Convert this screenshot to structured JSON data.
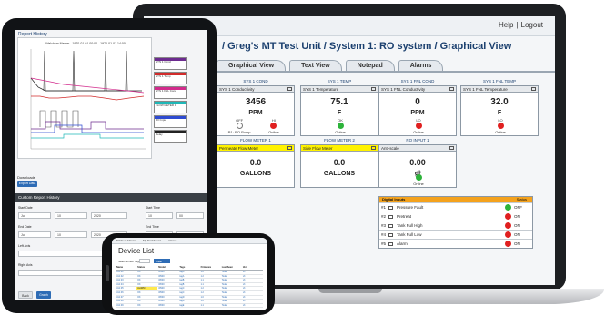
{
  "laptop": {
    "header_links": [
      "Help",
      "Logout"
    ],
    "page_title": "/ Greg's MT Test Unit / System 1: RO system / Graphical View",
    "tabs": [
      "Graphical View",
      "Text View",
      "Notepad",
      "Alarms"
    ],
    "cards": [
      {
        "caption": "SYS 1 COND",
        "header": "SYS 1 Conductivity",
        "value": "3456",
        "unit": "PPM",
        "indicators": [
          {
            "color": "white",
            "label": "OFF",
            "sub": "R1: RO Pump"
          },
          {
            "color": "red",
            "label": "HI",
            "sub": "Online"
          }
        ]
      },
      {
        "caption": "SYS 1 TEMP",
        "header": "SYS 1 Temperature",
        "value": "75.1",
        "unit": "F",
        "indicators": [
          {
            "color": "green",
            "label": "OK",
            "sub": "Online"
          }
        ]
      },
      {
        "caption": "SYS 1 FNL COND",
        "header": "SYS 1 FNL Conductivity",
        "value": "0",
        "unit": "PPM",
        "indicators": [
          {
            "color": "red",
            "label": "LO",
            "sub": "Online"
          }
        ]
      },
      {
        "caption": "SYS 1 FNL TEMP",
        "header": "SYS 1 FNL Temperature",
        "value": "32.0",
        "unit": "F",
        "indicators": [
          {
            "color": "red",
            "label": "LO",
            "sub": "Online"
          }
        ]
      },
      {
        "caption": "FLOW METER 1",
        "header": "Permeate Flow Meter",
        "value": "0.0",
        "unit": "GALLONS",
        "yellow": true,
        "indicators": []
      },
      {
        "caption": "FLOW METER 2",
        "header": "Side Flow Meter",
        "value": "0.0",
        "unit": "GALLONS",
        "yellow": true,
        "indicators": []
      },
      {
        "caption": "RO INPUT 1",
        "header": "Anti-scale",
        "value": "0.00",
        "unit": "gl",
        "indicators": [
          {
            "color": "green",
            "label": "OK",
            "sub": "Online"
          }
        ]
      }
    ],
    "alarms": {
      "header_left": "Digital Inputs",
      "header_right": "Status",
      "rows": [
        {
          "num": "#1",
          "label": "Pressure Fault",
          "status": "OFF",
          "color": "green"
        },
        {
          "num": "#2",
          "label": "Pretreat",
          "status": "ON",
          "color": "red"
        },
        {
          "num": "#3",
          "label": "Tank Full High",
          "status": "ON",
          "color": "red"
        },
        {
          "num": "#4",
          "label": "Tank Full Low",
          "status": "ON",
          "color": "red"
        },
        {
          "num": "#5",
          "label": "Alarm",
          "status": "ON",
          "color": "red"
        }
      ]
    }
  },
  "tablet": {
    "title": "Report History",
    "chart_header": "Walchem Master - 1970-01-01 00:00 - 1970-01-01 14:00",
    "legend": [
      {
        "color": "#6c2b8f",
        "text": "SYS 1 Cond"
      },
      {
        "color": "#d22b2b",
        "text": "SYS 1 Temp"
      },
      {
        "color": "#d22b8c",
        "text": "SYS 1 FNL Cond"
      },
      {
        "color": "#1fb8b8",
        "text": "FLOW METER 1"
      },
      {
        "color": "#2e4bd1",
        "text": "RO Input"
      },
      {
        "color": "#222222",
        "text": "Relay"
      }
    ],
    "downloads_label": "Downloads",
    "export_button": "Export Data",
    "section_title": "Custom Report History",
    "fields": {
      "start_date_label": "Start Date",
      "start_time_label": "Start Time",
      "end_date_label": "End Date",
      "end_time_label": "End Time",
      "left_axis_label": "Left Axis",
      "right_axis_label": "Right Axis",
      "start_month": "Jul",
      "start_day": "10",
      "start_year": "2020",
      "start_hour": "10",
      "start_min": "00",
      "end_month": "Jul",
      "end_day": "10",
      "end_year": "2020",
      "end_hour": "14",
      "end_min": "00"
    },
    "buttons": {
      "left": "Back",
      "right": "Graph"
    }
  },
  "phone": {
    "nav": [
      "Walchem Master",
      "My Dashboard",
      "Alarms"
    ],
    "title": "Device List",
    "filter_label": "Search/Filter Tags:",
    "filter_value": "",
    "filter_button": "Clear Filters",
    "columns": [
      "Name",
      "Status",
      "Model",
      "Tags",
      "Firmware",
      "Last Seen",
      "Ver"
    ],
    "rows": [
      [
        "Unit 01",
        "OK",
        "W900",
        "tagA",
        "1.2",
        "Today",
        "v3"
      ],
      [
        "Unit 02",
        "OK",
        "W900",
        "tagA",
        "1.2",
        "Today",
        "v3"
      ],
      [
        "Unit 03",
        "OK",
        "W600",
        "tagB",
        "1.1",
        "Today",
        "v3"
      ],
      [
        "Unit 04",
        "OK",
        "W600",
        "tagB",
        "1.1",
        "Today",
        "v3"
      ],
      [
        "Unit 05",
        "ALARM",
        "W900",
        "tagC",
        "1.2",
        "Today",
        "v3"
      ],
      [
        "Unit 06",
        "OK",
        "W900",
        "tagC",
        "1.2",
        "Today",
        "v3"
      ],
      [
        "Unit 07",
        "OK",
        "W600",
        "tagD",
        "1.0",
        "Today",
        "v3"
      ],
      [
        "Unit 08",
        "OK",
        "W900",
        "tagD",
        "1.2",
        "Today",
        "v3"
      ],
      [
        "Unit 09",
        "OK",
        "W600",
        "tagE",
        "1.1",
        "Today",
        "v3"
      ]
    ]
  }
}
